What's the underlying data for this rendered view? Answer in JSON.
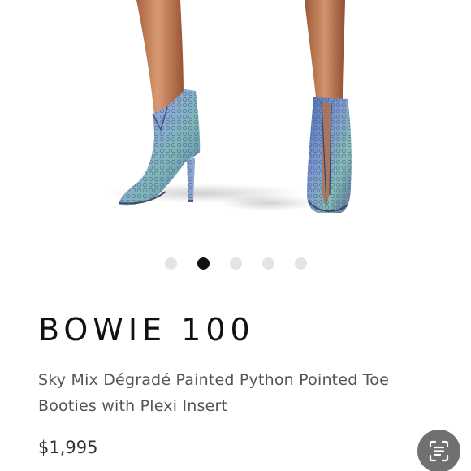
{
  "product": {
    "name": "BOWIE 100",
    "description": "Sky Mix Dégradé Painted Python Pointed Toe Booties with Plexi Insert",
    "price": "$1,995",
    "image": {
      "subject": "blue python ankle booties with high heels"
    }
  },
  "carousel": {
    "total_slides": 5,
    "active_index": 1
  },
  "scan_button": {
    "icon": "scan-text-icon"
  },
  "colors": {
    "dot_active": "#111111",
    "dot_inactive": "#e4e4e4",
    "title": "#111111",
    "description": "#555555",
    "price": "#333333",
    "scan_button_bg": "#707070"
  }
}
